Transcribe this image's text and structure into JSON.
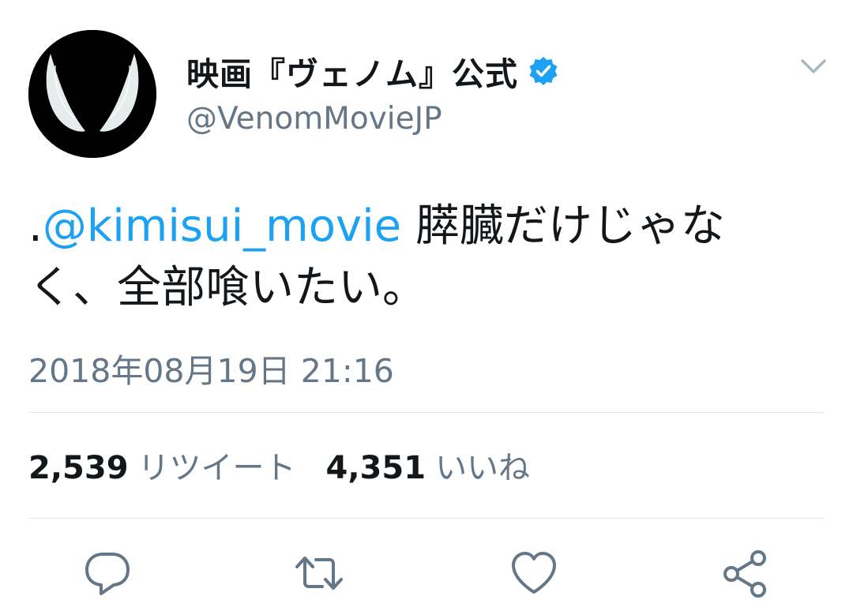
{
  "author": {
    "display_name": "映画『ヴェノム』公式",
    "handle": "@VenomMovieJP",
    "verified": true,
    "avatar_icon": "venom-eyes-icon"
  },
  "tweet": {
    "prefix": ".",
    "mention": "@kimisui_movie",
    "text_line1_rest": " 膵臓だけじゃな",
    "text_line2": "く、全部喰いたい。",
    "timestamp": "2018年08月19日 21:16"
  },
  "stats": {
    "retweets_count": "2,539",
    "retweets_label": "リツイート",
    "likes_count": "4,351",
    "likes_label": "いいね"
  },
  "actions": {
    "reply_icon": "reply-icon",
    "retweet_icon": "retweet-icon",
    "like_icon": "heart-icon",
    "share_icon": "share-icon",
    "menu_icon": "chevron-down-icon"
  },
  "colors": {
    "text": "#14171a",
    "secondary": "#657786",
    "accent": "#1da1f2",
    "divider": "#e1e8ed"
  }
}
